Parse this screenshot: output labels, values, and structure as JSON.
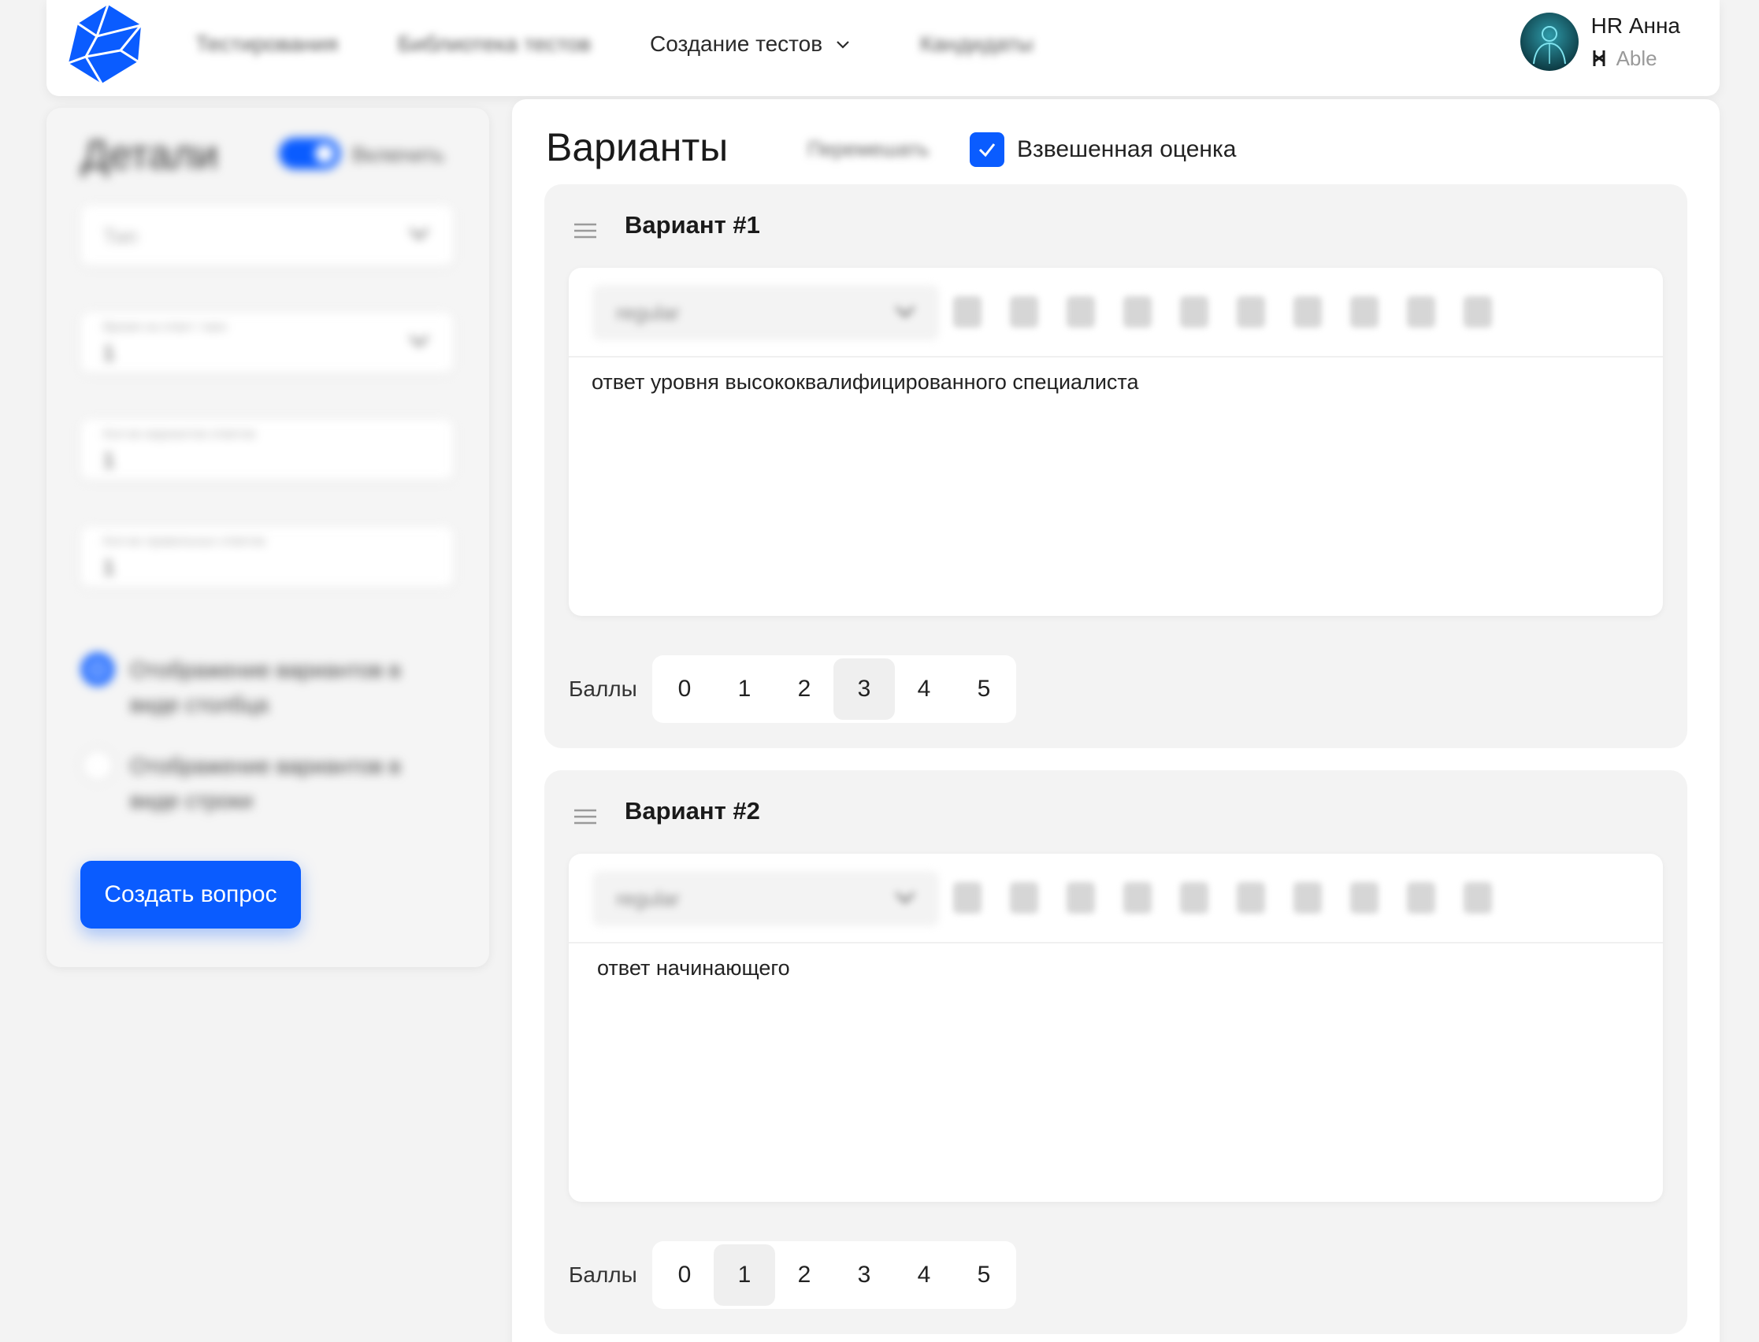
{
  "header": {
    "nav": [
      {
        "label": "Тестирования"
      },
      {
        "label": "Библиотека тестов"
      },
      {
        "label": "Создание тестов"
      },
      {
        "label": "Кандидаты"
      }
    ],
    "user": {
      "name": "HR Анна",
      "company": "Able"
    }
  },
  "left_panel": {
    "title": "Детали",
    "toggle_label": "Включить",
    "toggle_on": true,
    "type_placeholder": "Тип",
    "fields": [
      {
        "caption": "Время на ответ / мин",
        "value": "1"
      },
      {
        "caption": "Кол-во вариантов ответов",
        "value": "1"
      },
      {
        "caption": "Кол-во правильных ответов",
        "value": "1"
      }
    ],
    "display_options": [
      {
        "label": "Отображение вариантов в виде столбца",
        "selected": true
      },
      {
        "label": "Отображение вариантов в виде строки",
        "selected": false
      }
    ],
    "create_button": "Создать вопрос"
  },
  "variants_panel": {
    "title": "Варианты",
    "move_label": "Перемешать",
    "weighted_label": "Взвешенная оценка",
    "weighted_checked": true,
    "score_label": "Баллы",
    "toolbar_select_placeholder": "regular",
    "variants": [
      {
        "title": "Вариант #1",
        "text": "ответ уровня высококвалифицированного специалиста",
        "selected_score": 3
      },
      {
        "title": "Вариант #2",
        "text": "ответ начинающего",
        "selected_score": 1
      }
    ],
    "scores": [
      "0",
      "1",
      "2",
      "3",
      "4",
      "5"
    ]
  },
  "colors": {
    "accent": "#0a5cff",
    "background": "#f3f3f3"
  }
}
